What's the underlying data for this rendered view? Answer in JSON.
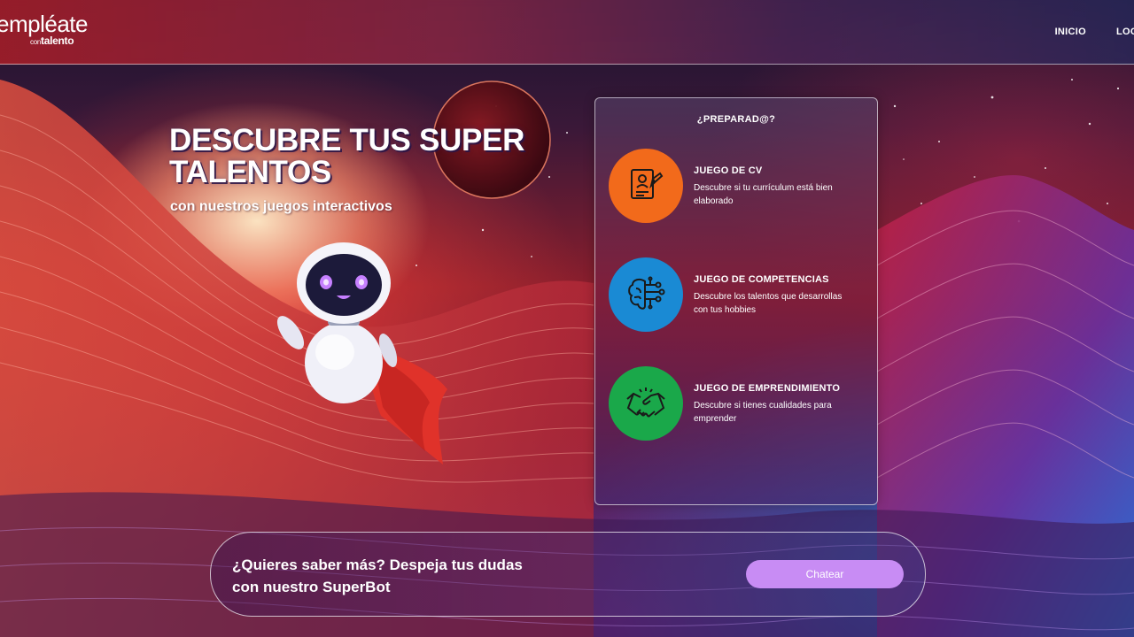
{
  "header": {
    "logo_main": "empléate",
    "logo_sub_small": "con",
    "logo_sub": "talento",
    "nav": [
      {
        "label": "INICIO"
      },
      {
        "label": "LOG"
      }
    ]
  },
  "hero": {
    "title": "DESCUBRE TUS SUPER TALENTOS",
    "subtitle": "con nuestros juegos interactivos"
  },
  "panel": {
    "title": "¿PREPARAD@?",
    "games": [
      {
        "title": "JUEGO DE CV",
        "description": "Descubre si tu currículum está bien elaborado",
        "color": "#f26a1b",
        "icon": "resume-icon"
      },
      {
        "title": "JUEGO DE COMPETENCIAS",
        "description": "Descubre los talentos que desarrollas con tus hobbies",
        "color": "#1a8ad4",
        "icon": "brain-circuit-icon"
      },
      {
        "title": "JUEGO DE EMPRENDIMIENTO",
        "description": "Descubre si tienes cualidades para emprender",
        "color": "#1aa84a",
        "icon": "handshake-icon"
      }
    ]
  },
  "chat": {
    "text": "¿Quieres saber más? Despeja tus dudas con nuestro SuperBot",
    "button_label": "Chatear",
    "button_color": "#c88cf4"
  },
  "mascot": {
    "icon": "superhero-robot-icon"
  }
}
